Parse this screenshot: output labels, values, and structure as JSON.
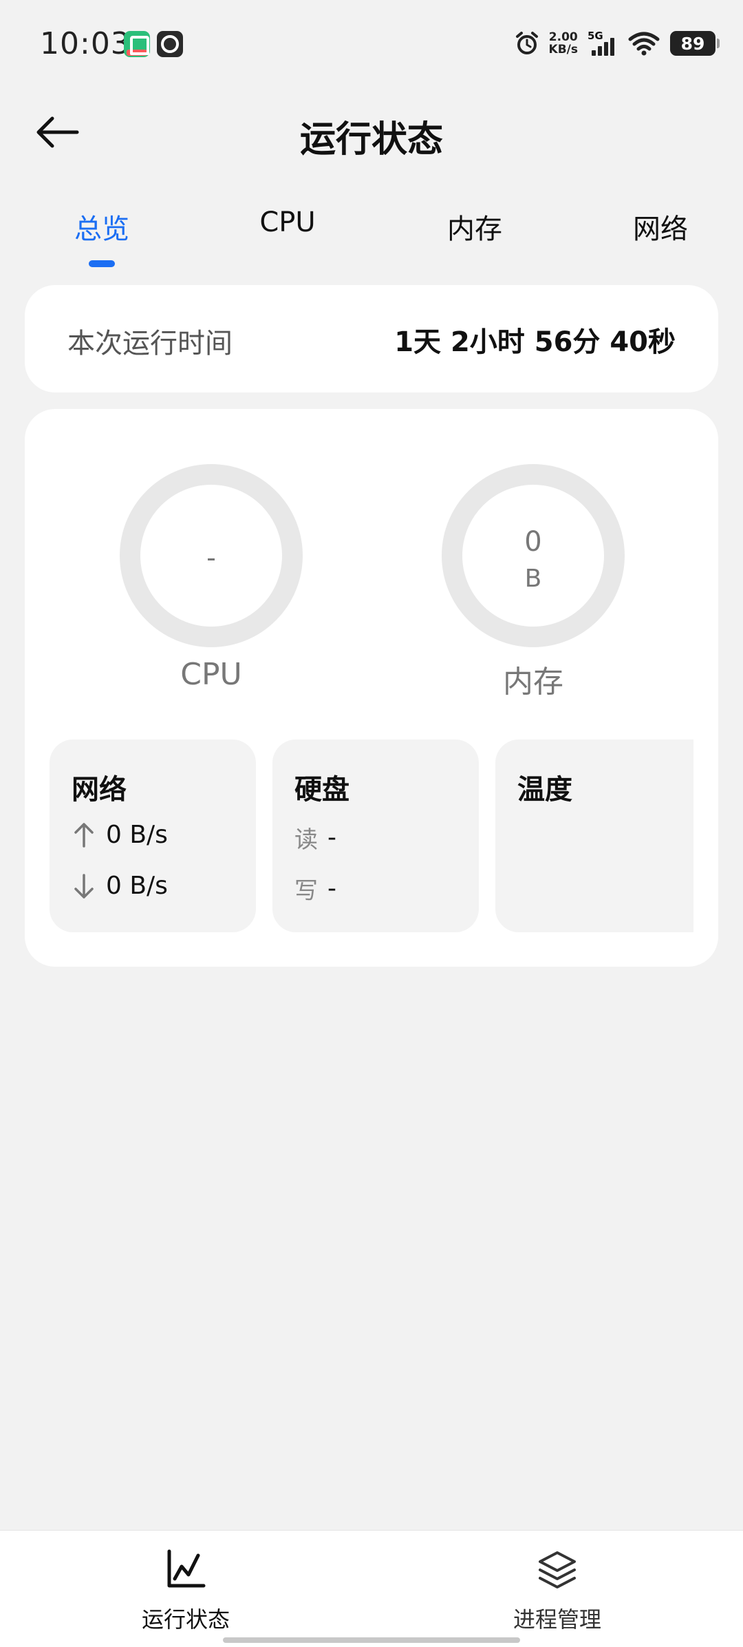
{
  "status_bar": {
    "time": "10:03",
    "speed_value": "2.00",
    "speed_unit": "KB/s",
    "network": "5G",
    "battery": "89"
  },
  "header": {
    "title": "运行状态"
  },
  "tabs": [
    {
      "label": "总览",
      "active": true
    },
    {
      "label": "CPU",
      "active": false
    },
    {
      "label": "内存",
      "active": false
    },
    {
      "label": "网络",
      "active": false
    }
  ],
  "uptime": {
    "label": "本次运行时间",
    "value": "1天 2小时 56分 40秒"
  },
  "gauges": {
    "cpu": {
      "value": "-",
      "label": "CPU"
    },
    "memory": {
      "value": "0",
      "unit": "B",
      "label": "内存"
    }
  },
  "mini_cards": {
    "network": {
      "title": "网络",
      "upload": "0 B/s",
      "download": "0 B/s"
    },
    "disk": {
      "title": "硬盘",
      "read_label": "读",
      "read_value": "-",
      "write_label": "写",
      "write_value": "-"
    },
    "temperature": {
      "title": "温度"
    }
  },
  "bottom_nav": [
    {
      "label": "运行状态",
      "icon": "line-chart-icon",
      "active": true
    },
    {
      "label": "进程管理",
      "icon": "layers-icon",
      "active": false
    }
  ],
  "colors": {
    "accent": "#1b6ef3",
    "background": "#f2f2f2",
    "card": "#ffffff",
    "gauge_track": "#e8e8e8"
  }
}
